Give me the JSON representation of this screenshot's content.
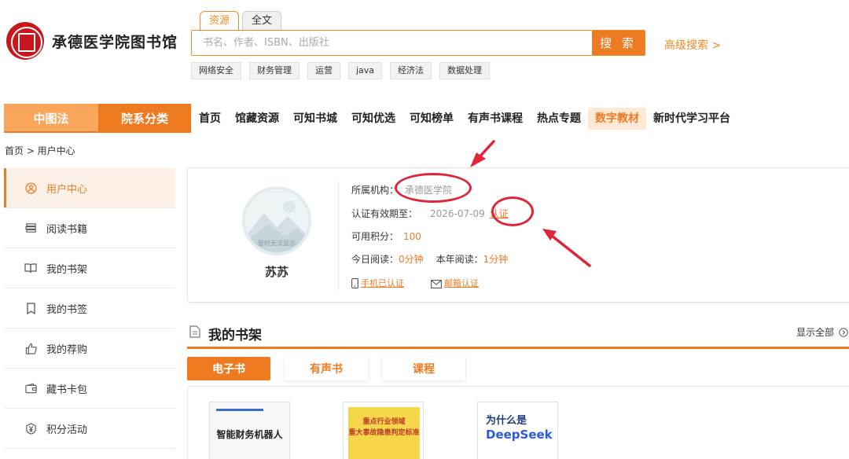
{
  "header": {
    "library_name": "承德医学院图书馆",
    "search_tabs": [
      "资源",
      "全文"
    ],
    "search_placeholder": "书名、作者、ISBN、出版社",
    "search_button": "搜 索",
    "advanced_search": "高级搜索 >",
    "hot_tags": [
      "网络安全",
      "财务管理",
      "运营",
      "java",
      "经济法",
      "数据处理"
    ]
  },
  "nav": {
    "categories": [
      "中图法",
      "院系分类"
    ],
    "items": [
      "首页",
      "馆藏资源",
      "可知书城",
      "可知优选",
      "可知榜单",
      "有声书课程",
      "热点专题",
      "数字教材",
      "新时代学习平台"
    ]
  },
  "breadcrumb": "首页 > 用户中心",
  "sidebar": {
    "items": [
      {
        "label": "用户中心",
        "icon": "user-circle-icon"
      },
      {
        "label": "阅读书籍",
        "icon": "books-icon"
      },
      {
        "label": "我的书架",
        "icon": "open-book-icon"
      },
      {
        "label": "我的书签",
        "icon": "bookmark-icon"
      },
      {
        "label": "我的荐购",
        "icon": "thumbs-up-icon"
      },
      {
        "label": "藏书卡包",
        "icon": "wallet-icon"
      },
      {
        "label": "积分活动",
        "icon": "yen-coin-icon"
      }
    ]
  },
  "user": {
    "avatar_text": "暂时无法显示",
    "name": "苏苏",
    "institution_label": "所属机构：",
    "institution": "承德医学院",
    "validity_label": "认证有效期至：",
    "validity_date": "2026-07-09",
    "certify_link": "认证",
    "points_label": "可用积分：",
    "points": "100",
    "today_label": "今日阅读：",
    "today_value": "0分钟",
    "year_label": "本年阅读：",
    "year_value": "1分钟",
    "phone_verified": "手机已认证",
    "email_verify": "邮箱认证"
  },
  "shelf": {
    "title": "我的书架",
    "show_all": "显示全部",
    "tabs": [
      "电子书",
      "有声书",
      "课程"
    ],
    "books": [
      {
        "title": "智能财务机器人"
      },
      {
        "title_line1": "重点行业领域",
        "title_line2": "重大事故隐患判定标准"
      },
      {
        "title_line1": "为什么是",
        "title_line2": "DeepSeek"
      }
    ]
  },
  "colors": {
    "accent": "#ee7b22",
    "accent_light": "#f9a65a",
    "annotation": "#e0243a"
  }
}
